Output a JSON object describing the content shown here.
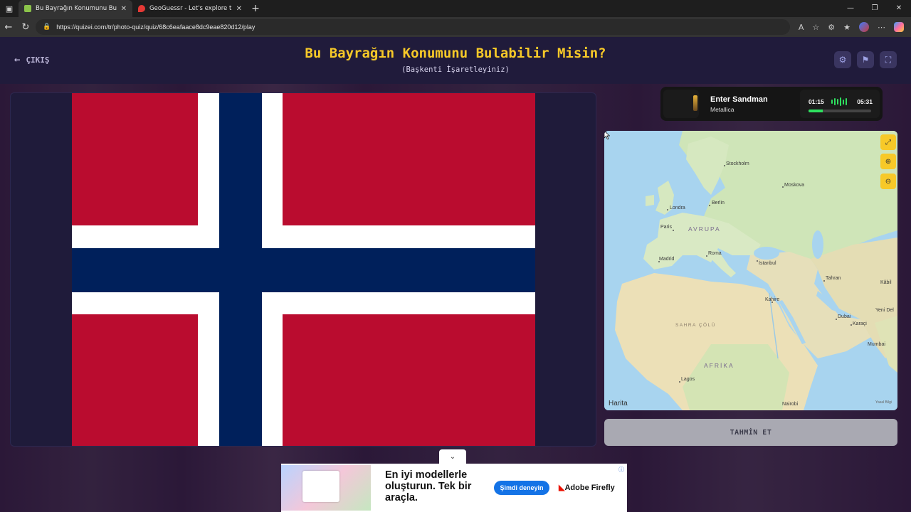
{
  "browser": {
    "tabs": [
      {
        "title": "Bu Bayrağın Konumunu Bulabilir M",
        "active": true
      },
      {
        "title": "GeoGuessr - Let's explore the wo",
        "active": false
      }
    ],
    "url": "https://quizei.com/tr/photo-quiz/quiz/68c6eafaace8dc9eae820d12/play"
  },
  "header": {
    "exit_label": "ÇIKIŞ",
    "title": "Bu Bayrağın Konumunu Bulabilir Misin?",
    "subtitle": "(Başkenti İşaretleyiniz)",
    "buttons": [
      "settings-icon",
      "flag-icon",
      "fullscreen-icon"
    ]
  },
  "flag": {
    "country_colors": {
      "red": "#BA0C2F",
      "white": "#FFFFFF",
      "blue": "#00205B"
    }
  },
  "music": {
    "song": "Enter Sandman",
    "artist": "Metallica",
    "current_time": "01:15",
    "total_time": "05:31",
    "progress": 0.23
  },
  "map": {
    "cities": [
      "Stockholm",
      "Moskova",
      "Londra",
      "Berlin",
      "Paris",
      "Madrid",
      "Roma",
      "İstanbul",
      "Tahran",
      "Kâbil",
      "Kahire",
      "Dubai",
      "Yeni Del",
      "Karaçi",
      "Mumbai",
      "Lagos",
      "Nairobi"
    ],
    "regions": {
      "europe": "AVRUPA",
      "sahara": "SAHRA ÇÖLÜ",
      "africa": "AFRİKA"
    },
    "attribution": "Harita",
    "legal": "Yasal Bilgi",
    "controls": [
      "expand-icon",
      "zoom-in-icon",
      "zoom-out-icon"
    ]
  },
  "guess_button": "TAHMİN ET",
  "ad": {
    "headline": "En iyi modellerle oluşturun. Tek bir araçla.",
    "cta": "Şimdi deneyin",
    "brand_prefix": "Adobe",
    "brand_product": "Firefly"
  }
}
